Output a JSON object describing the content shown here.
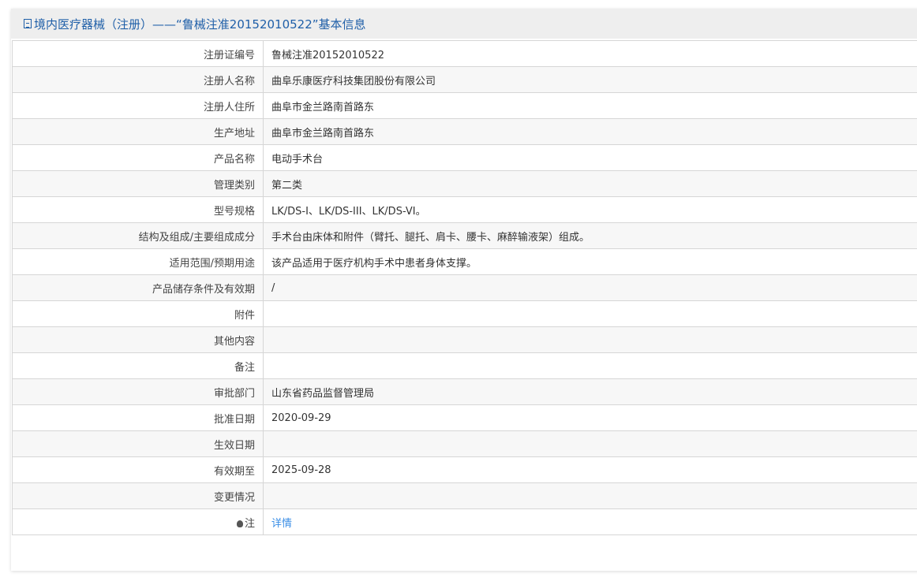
{
  "header": {
    "title": "境内医疗器械（注册）——“鲁械注准20152010522”基本信息",
    "icon": "document-icon"
  },
  "rows": [
    {
      "label": "注册证编号",
      "value": "鲁械注准20152010522"
    },
    {
      "label": "注册人名称",
      "value": "曲阜乐康医疗科技集团股份有限公司"
    },
    {
      "label": "注册人住所",
      "value": "曲阜市金兰路南首路东"
    },
    {
      "label": "生产地址",
      "value": "曲阜市金兰路南首路东"
    },
    {
      "label": "产品名称",
      "value": "电动手术台"
    },
    {
      "label": "管理类别",
      "value": "第二类"
    },
    {
      "label": "型号规格",
      "value": "LK/DS-I、LK/DS-III、LK/DS-VI。"
    },
    {
      "label": "结构及组成/主要组成成分",
      "value": "手术台由床体和附件（臂托、腿托、肩卡、腰卡、麻醉输液架）组成。"
    },
    {
      "label": "适用范围/预期用途",
      "value": "该产品适用于医疗机构手术中患者身体支撑。"
    },
    {
      "label": "产品储存条件及有效期",
      "value": "/"
    },
    {
      "label": "附件",
      "value": ""
    },
    {
      "label": "其他内容",
      "value": ""
    },
    {
      "label": "备注",
      "value": ""
    },
    {
      "label": "审批部门",
      "value": "山东省药品监督管理局"
    },
    {
      "label": "批准日期",
      "value": "2020-09-29"
    },
    {
      "label": "生效日期",
      "value": ""
    },
    {
      "label": "有效期至",
      "value": "2025-09-28"
    },
    {
      "label": "变更情况",
      "value": ""
    }
  ],
  "note": {
    "label": "注",
    "link": "详情",
    "icon": "lightbulb-icon"
  }
}
